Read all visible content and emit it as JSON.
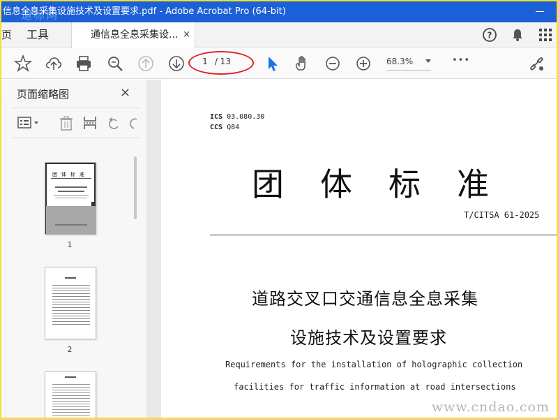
{
  "window": {
    "title": "信息全息采集设施技术及设置要求.pdf - Adobe Acrobat Pro (64-bit)"
  },
  "watermark": {
    "top": "道标网",
    "bottom": "www.cndao.com"
  },
  "tabs": {
    "prev_partial": "页",
    "tools": "工具",
    "document": "通信息全息采集设...",
    "close": "×"
  },
  "toolbar": {
    "current_page": "1",
    "total_pages": "/ 13",
    "zoom": "68.3%",
    "more": "•••"
  },
  "left_panel": {
    "title": "页面缩略图",
    "close": "×",
    "thumbnails": [
      {
        "label": "1"
      },
      {
        "label": "2"
      }
    ]
  },
  "document": {
    "ics_label": "ICS",
    "ics_value": "03.080.30",
    "ccs_label": "CCS",
    "ccs_value": "Q84",
    "standard_type": "团体标准",
    "standard_number": "T/CITSA 61-2025",
    "title_cn_line1": "道路交叉口交通信息全息采集",
    "title_cn_line2": "设施技术及设置要求",
    "title_en_line1": "Requirements for the installation of holographic collection",
    "title_en_line2": "facilities for traffic information at road intersections"
  },
  "colors": {
    "titlebar": "#1c60d8",
    "frame": "#f0e22a",
    "annotation": "#e02020",
    "select_tool": "#1a73e8"
  }
}
